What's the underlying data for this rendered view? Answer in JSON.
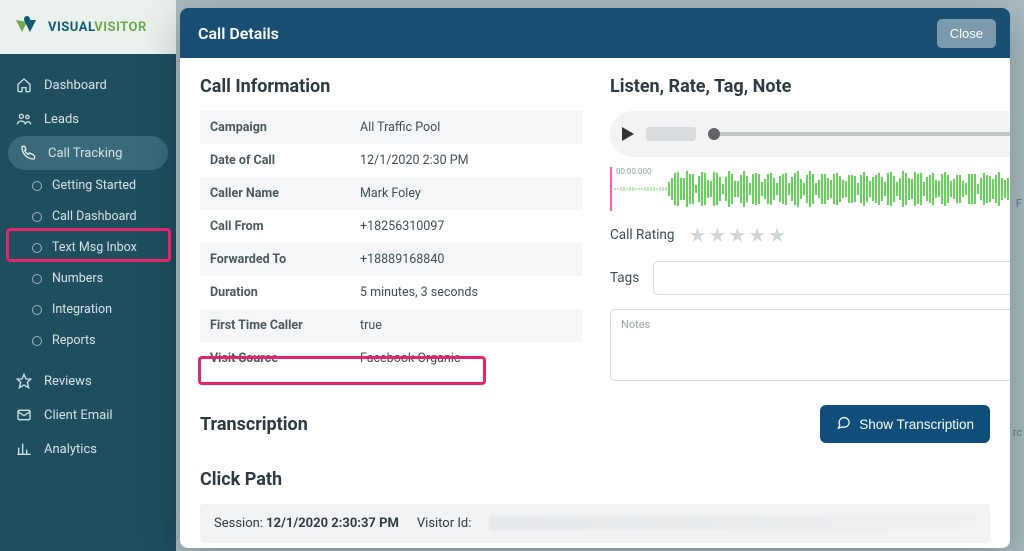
{
  "brand": {
    "part1": "VISUAL",
    "part2": "VISITOR"
  },
  "sidebar": {
    "items": [
      {
        "label": "Dashboard"
      },
      {
        "label": "Leads"
      },
      {
        "label": "Call Tracking"
      }
    ],
    "subitems": [
      {
        "label": "Getting Started"
      },
      {
        "label": "Call Dashboard"
      },
      {
        "label": "Text Msg Inbox"
      },
      {
        "label": "Numbers"
      },
      {
        "label": "Integration"
      },
      {
        "label": "Reports"
      }
    ],
    "tail": [
      {
        "label": "Reviews"
      },
      {
        "label": "Client Email"
      },
      {
        "label": "Analytics"
      }
    ]
  },
  "modal": {
    "title": "Call Details",
    "close": "Close",
    "info_heading": "Call Information",
    "listen_heading": "Listen, Rate, Tag, Note",
    "fields": [
      {
        "k": "Campaign",
        "v": "All Traffic Pool"
      },
      {
        "k": "Date of Call",
        "v": "12/1/2020 2:30 PM"
      },
      {
        "k": "Caller Name",
        "v": "Mark Foley"
      },
      {
        "k": "Call From",
        "v": "+18256310097"
      },
      {
        "k": "Forwarded To",
        "v": "+18889168840"
      },
      {
        "k": "Duration",
        "v": "5 minutes, 3 seconds"
      },
      {
        "k": "First Time Caller",
        "v": "true"
      },
      {
        "k": "Visit Source",
        "v": "Facebook Organic"
      }
    ],
    "waveform_time": "00:00.000",
    "rating_label": "Call Rating",
    "tags_label": "Tags",
    "notes_placeholder": "Notes",
    "transcription_heading": "Transcription",
    "show_transcription": "Show Transcription",
    "clickpath_heading": "Click Path",
    "session_label": "Session: ",
    "session_time": "12/1/2020 2:30:37 PM",
    "visitor_id_label": "Visitor Id:"
  },
  "bg_peek": "F",
  "bg_peek2": "rc"
}
